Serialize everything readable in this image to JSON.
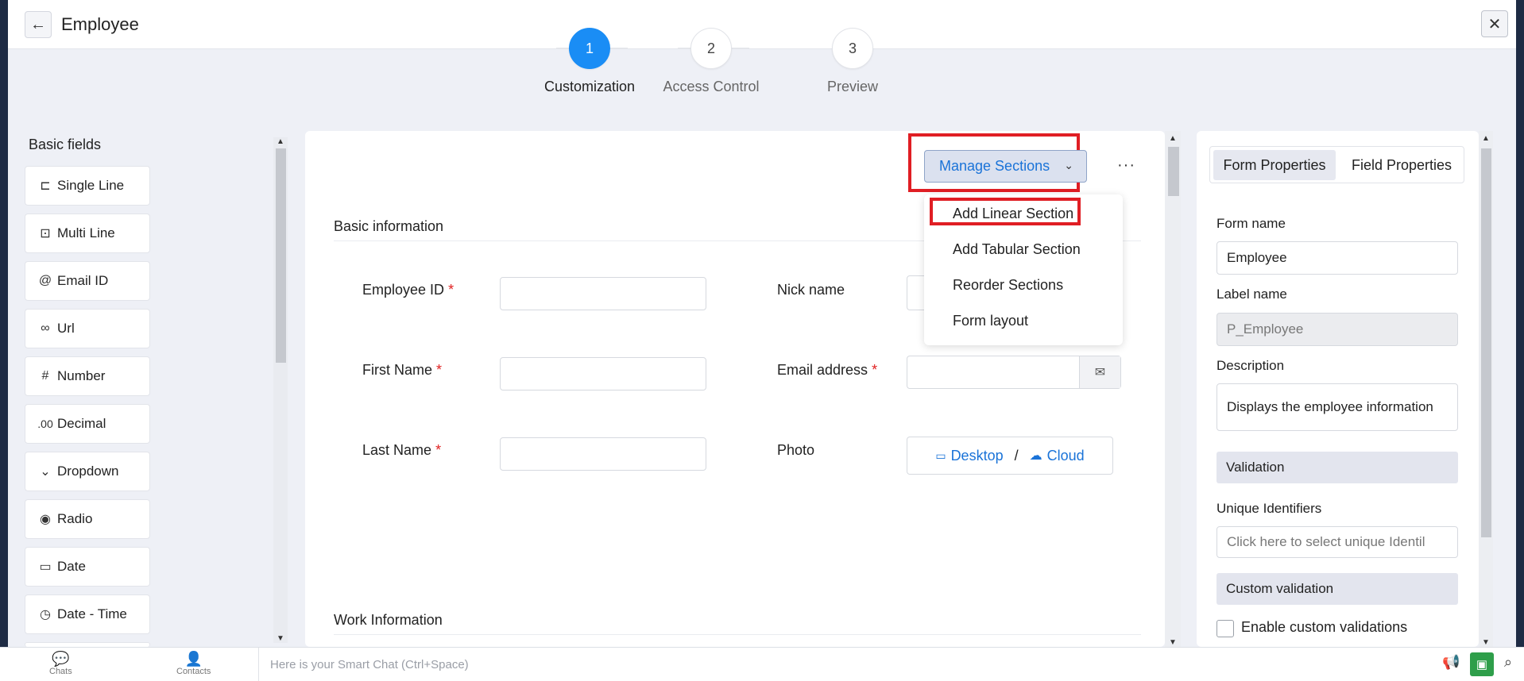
{
  "header": {
    "back_icon": "←",
    "title": "Employee",
    "close_icon": "✕"
  },
  "steps": [
    {
      "number": "1",
      "label": "Customization",
      "active": true
    },
    {
      "number": "2",
      "label": "Access Control",
      "active": false
    },
    {
      "number": "3",
      "label": "Preview",
      "active": false
    }
  ],
  "left_panel": {
    "title": "Basic fields",
    "fields": [
      {
        "icon": "⊏",
        "label": "Single Line"
      },
      {
        "icon": "⊡",
        "label": "Multi Line"
      },
      {
        "icon": "@",
        "label": "Email ID"
      },
      {
        "icon": "∞",
        "label": "Url"
      },
      {
        "icon": "#",
        "label": "Number"
      },
      {
        "icon": ".00",
        "label": "Decimal"
      },
      {
        "icon": "⌄",
        "label": "Dropdown"
      },
      {
        "icon": "◉",
        "label": "Radio"
      },
      {
        "icon": "▭",
        "label": "Date"
      },
      {
        "icon": "◷",
        "label": "Date - Time"
      }
    ]
  },
  "toolbar": {
    "manage_sections": "Manage Sections",
    "chevron": "⌄",
    "more": "···"
  },
  "dropdown_menu": {
    "items": [
      "Add Linear Section",
      "Add Tabular Section",
      "Reorder Sections",
      "Form layout"
    ]
  },
  "sections": {
    "basic": "Basic information",
    "work": "Work Information"
  },
  "form_fields": {
    "employee_id": "Employee ID",
    "first_name": "First Name",
    "last_name": "Last Name",
    "nick_name": "Nick name",
    "email_address": "Email address",
    "photo": "Photo",
    "required_mark": "*",
    "email_icon": "✉",
    "photo_desktop": "Desktop",
    "photo_sep": "/",
    "photo_cloud": "Cloud",
    "desktop_icon": "▭",
    "cloud_icon": "☁"
  },
  "right_panel": {
    "tabs": [
      "Form Properties",
      "Field Properties"
    ],
    "form_name_label": "Form name",
    "form_name_value": "Employee",
    "label_name_label": "Label name",
    "label_name_value": "P_Employee",
    "description_label": "Description",
    "description_value": "Displays the employee information",
    "validation": "Validation",
    "unique_identifiers_label": "Unique Identifiers",
    "unique_identifiers_placeholder": "Click here to select unique Identil",
    "custom_validation": "Custom validation",
    "enable_custom_validations": "Enable custom validations"
  },
  "bottom_bar": {
    "chats": "Chats",
    "contacts": "Contacts",
    "smart_chat_placeholder": "Here is your Smart Chat (Ctrl+Space)"
  },
  "colors": {
    "accent": "#1a8df5",
    "highlight": "#e01e24",
    "modal_bg": "#eef0f6",
    "backdrop": "#1e2b44"
  }
}
